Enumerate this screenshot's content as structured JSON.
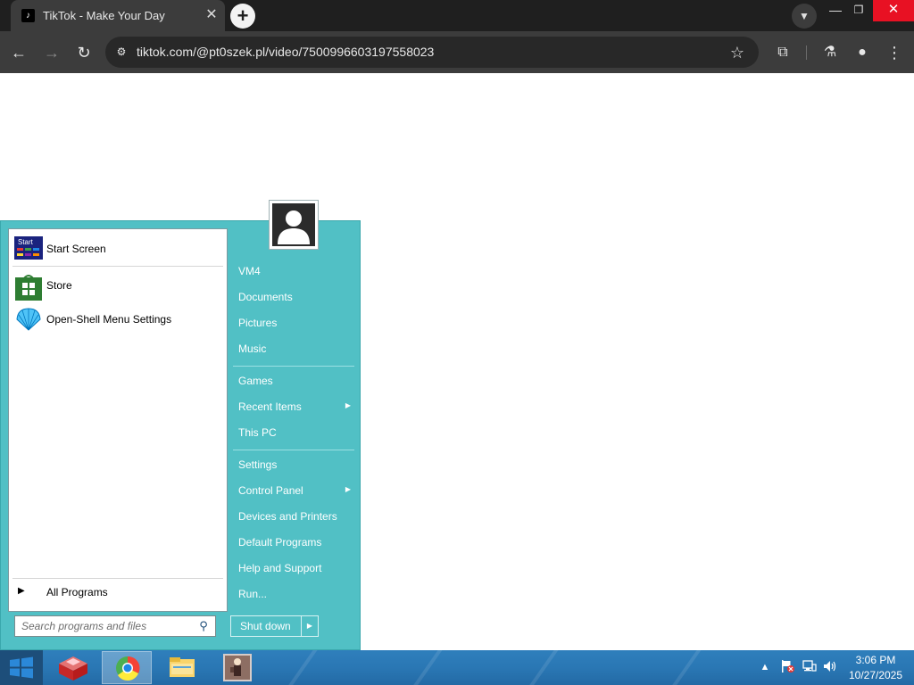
{
  "browser": {
    "tab_title": "TikTok - Make Your Day",
    "favicon": "tiktok-icon",
    "url": "tiktok.com/@pt0szek.pl/video/7500996603197558023"
  },
  "start_menu": {
    "pinned": [
      {
        "label": "Start Screen",
        "icon": "start-screen-icon",
        "icon_text": "Start"
      },
      {
        "label": "Store",
        "icon": "store-icon"
      },
      {
        "label": "Open-Shell Menu Settings",
        "icon": "open-shell-icon"
      }
    ],
    "all_programs": "All Programs",
    "search_placeholder": "Search programs and files",
    "right_items": [
      {
        "label": "VM4",
        "submenu": false
      },
      {
        "label": "Documents",
        "submenu": false
      },
      {
        "label": "Pictures",
        "submenu": false
      },
      {
        "label": "Music",
        "submenu": false
      },
      {
        "label": "Games",
        "submenu": false
      },
      {
        "label": "Recent Items",
        "submenu": true
      },
      {
        "label": "This PC",
        "submenu": false
      },
      {
        "label": "Settings",
        "submenu": false
      },
      {
        "label": "Control Panel",
        "submenu": true
      },
      {
        "label": "Devices and Printers",
        "submenu": false
      },
      {
        "label": "Default Programs",
        "submenu": false
      },
      {
        "label": "Help and Support",
        "submenu": false
      },
      {
        "label": "Run...",
        "submenu": false
      }
    ],
    "shutdown_label": "Shut down"
  },
  "taskbar": {
    "apps": [
      {
        "name": "app-red-icon",
        "active": false
      },
      {
        "name": "chrome-icon",
        "active": true
      },
      {
        "name": "file-explorer-icon",
        "active": false
      },
      {
        "name": "app-figure-icon",
        "active": false
      }
    ],
    "time": "3:06 PM",
    "date": "10/27/2025"
  },
  "colors": {
    "start_menu_bg": "#51c0c5",
    "taskbar": "#2a77b4",
    "browser_toolbar": "#3c3c3c"
  }
}
